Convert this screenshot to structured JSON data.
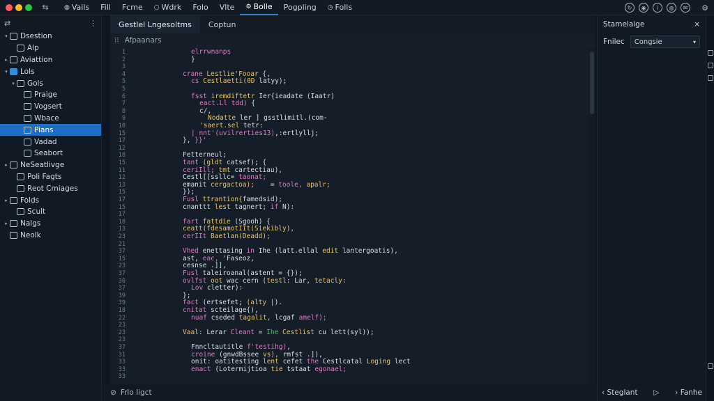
{
  "window": {
    "traffic_colors": [
      "#ff5f57",
      "#febc2e",
      "#28c840"
    ]
  },
  "menu": {
    "items": [
      {
        "label": "Vails",
        "icon": "globe-icon"
      },
      {
        "label": "Fill",
        "icon": ""
      },
      {
        "label": "Fcme",
        "icon": ""
      },
      {
        "label": "Wdrk",
        "icon": "circle-icon"
      },
      {
        "label": "Folo",
        "icon": ""
      },
      {
        "label": "Vlte",
        "icon": ""
      },
      {
        "label": "Bolle",
        "icon": "settings-icon"
      },
      {
        "label": "Pogpling",
        "icon": ""
      },
      {
        "label": "Folls",
        "icon": "clock-icon"
      }
    ],
    "active_index": 6
  },
  "sidebar": {
    "items": [
      {
        "label": "Dsestion",
        "depth": 0,
        "arrow": "▾"
      },
      {
        "label": "Alp",
        "depth": 1,
        "arrow": ""
      },
      {
        "label": "Aviattion",
        "depth": 0,
        "arrow": "▸"
      },
      {
        "label": "Lols",
        "depth": 0,
        "arrow": "▾",
        "blue": true
      },
      {
        "label": "Gols",
        "depth": 1,
        "arrow": "▾"
      },
      {
        "label": "Praige",
        "depth": 2,
        "arrow": ""
      },
      {
        "label": "Vogsert",
        "depth": 2,
        "arrow": ""
      },
      {
        "label": "Wbace",
        "depth": 2,
        "arrow": ""
      },
      {
        "label": "Pians",
        "depth": 2,
        "arrow": "",
        "selected": true
      },
      {
        "label": "Vadad",
        "depth": 2,
        "arrow": ""
      },
      {
        "label": "Seabort",
        "depth": 2,
        "arrow": ""
      },
      {
        "label": "NeSeatlivge",
        "depth": 0,
        "arrow": "▸"
      },
      {
        "label": "Poli Fagts",
        "depth": 1,
        "arrow": ""
      },
      {
        "label": "Reot Cmiages",
        "depth": 1,
        "arrow": ""
      },
      {
        "label": "Folds",
        "depth": 0,
        "arrow": "▸"
      },
      {
        "label": "Scult",
        "depth": 1,
        "arrow": ""
      },
      {
        "label": "Nalgs",
        "depth": 0,
        "arrow": "▸"
      },
      {
        "label": "Neolk",
        "depth": 0,
        "arrow": ""
      }
    ]
  },
  "editor": {
    "tabs": [
      {
        "label": "Gestlel Lngesoltms",
        "active": true
      },
      {
        "label": "Coptun",
        "active": false
      }
    ],
    "breadcrumb": "Afpaanars",
    "line_numbers": [
      "1",
      "2",
      "3",
      "4",
      "5",
      "5",
      "6",
      "7",
      "8",
      "9",
      "10",
      "15",
      "17",
      "12",
      "18",
      "15",
      "11",
      "12",
      "13",
      "15",
      "17",
      "15",
      "17",
      "18",
      "13",
      "23",
      "21",
      "37",
      "15",
      "23",
      "37",
      "30",
      "37",
      "39",
      "39",
      "18",
      "22",
      "23",
      "23",
      "23",
      "37",
      "31",
      "33",
      "33",
      "33"
    ],
    "lines": [
      {
        "indent": 6,
        "parts": [
          [
            "elrrwnanps",
            "#e07bc6"
          ]
        ]
      },
      {
        "indent": 6,
        "parts": [
          [
            "}",
            "#d7dee6"
          ]
        ]
      },
      {
        "indent": 0,
        "parts": []
      },
      {
        "indent": 5,
        "parts": [
          [
            "crane ",
            "#e07bc6"
          ],
          [
            "Lestlie'Fooar",
            "#e8c46a"
          ],
          [
            " {,",
            "#d7dee6"
          ]
        ]
      },
      {
        "indent": 6,
        "parts": [
          [
            "cs ",
            "#e07bc6"
          ],
          [
            "Cestlaetti(0D ",
            "#e8c46a"
          ],
          [
            "latyy);",
            "#d7dee6"
          ]
        ]
      },
      {
        "indent": 0,
        "parts": []
      },
      {
        "indent": 6,
        "parts": [
          [
            "fsst ",
            "#e07bc6"
          ],
          [
            "iremdiftetr ",
            "#e8c46a"
          ],
          [
            "Ier{ieadate (Iaatr)",
            "#d7dee6"
          ]
        ]
      },
      {
        "indent": 7,
        "parts": [
          [
            "eact.Ll tdd) ",
            "#e07bc6"
          ],
          [
            "{",
            "#d7dee6"
          ]
        ]
      },
      {
        "indent": 7,
        "parts": [
          [
            "c/,",
            "#d7dee6"
          ]
        ]
      },
      {
        "indent": 8,
        "parts": [
          [
            "Nodatte ",
            "#e8c46a"
          ],
          [
            "ler ] gsstlimitl.(com-",
            "#d7dee6"
          ]
        ]
      },
      {
        "indent": 7,
        "parts": [
          [
            "'saert.sel ",
            "#e8c46a"
          ],
          [
            "tetr:",
            "#d7dee6"
          ]
        ]
      },
      {
        "indent": 6,
        "parts": [
          [
            "| nnt'(uvilrerties13)",
            "#e07bc6"
          ],
          [
            ",:ertlyllj;",
            "#d7dee6"
          ]
        ]
      },
      {
        "indent": 5,
        "parts": [
          [
            "}, ",
            "#d7dee6"
          ],
          [
            "}}'",
            "#e07bc6"
          ]
        ]
      },
      {
        "indent": 0,
        "parts": []
      },
      {
        "indent": 5,
        "parts": [
          [
            "Fetterneul;",
            "#d7dee6"
          ]
        ]
      },
      {
        "indent": 5,
        "parts": [
          [
            "tant ",
            "#e07bc6"
          ],
          [
            "(gldt ",
            "#e8c46a"
          ],
          [
            "catsef); {",
            "#d7dee6"
          ]
        ]
      },
      {
        "indent": 5,
        "parts": [
          [
            "ceriIll; ",
            "#e07bc6"
          ],
          [
            "tmt ",
            "#e8c46a"
          ],
          [
            "cartectiau),",
            "#d7dee6"
          ]
        ]
      },
      {
        "indent": 5,
        "parts": [
          [
            "Cestl[[ssllc= ",
            "#d7dee6"
          ],
          [
            "taonat;",
            "#e07bc6"
          ]
        ]
      },
      {
        "indent": 5,
        "parts": [
          [
            "emanit ",
            "#d7dee6"
          ],
          [
            "cergactoa);",
            "#e8c46a"
          ],
          [
            "    = ",
            "#d7dee6"
          ],
          [
            "toole, ",
            "#e07bc6"
          ],
          [
            "apalr;",
            "#e8c46a"
          ]
        ]
      },
      {
        "indent": 5,
        "parts": [
          [
            "});",
            "#d7dee6"
          ]
        ]
      },
      {
        "indent": 5,
        "parts": [
          [
            "Fusl ",
            "#e07bc6"
          ],
          [
            "ttrantion{",
            "#e8c46a"
          ],
          [
            "famedsid);",
            "#d7dee6"
          ]
        ]
      },
      {
        "indent": 5,
        "parts": [
          [
            "cnanttt ",
            "#d7dee6"
          ],
          [
            "lest ",
            "#e8c46a"
          ],
          [
            "tagnert; ",
            "#d7dee6"
          ],
          [
            "if ",
            "#e07bc6"
          ],
          [
            "N):",
            "#d7dee6"
          ]
        ]
      },
      {
        "indent": 0,
        "parts": []
      },
      {
        "indent": 5,
        "parts": [
          [
            "fart ",
            "#e07bc6"
          ],
          [
            "fattdie ",
            "#e8c46a"
          ],
          [
            "(Sgooh) {",
            "#d7dee6"
          ]
        ]
      },
      {
        "indent": 5,
        "parts": [
          [
            "ceatt(fdesamotIIt(Siekibly),",
            "#e8c46a"
          ]
        ]
      },
      {
        "indent": 5,
        "parts": [
          [
            "cerIIt ",
            "#e07bc6"
          ],
          [
            "Baetlan(Deadd);",
            "#e8c46a"
          ]
        ]
      },
      {
        "indent": 0,
        "parts": []
      },
      {
        "indent": 5,
        "parts": [
          [
            "Vhed ",
            "#e07bc6"
          ],
          [
            "enettasing ",
            "#d7dee6"
          ],
          [
            "in ",
            "#e07bc6"
          ],
          [
            "Ihe (latt.ellal ",
            "#d7dee6"
          ],
          [
            "edit ",
            "#e8c46a"
          ],
          [
            "lantergoatis),",
            "#d7dee6"
          ]
        ]
      },
      {
        "indent": 5,
        "parts": [
          [
            "ast, ",
            "#d7dee6"
          ],
          [
            "eac, ",
            "#e07bc6"
          ],
          [
            "'Faseoz,",
            "#d7dee6"
          ]
        ]
      },
      {
        "indent": 5,
        "parts": [
          [
            "cesnse ",
            "#d7dee6"
          ],
          [
            ".]],",
            "#d7dee6"
          ]
        ]
      },
      {
        "indent": 5,
        "parts": [
          [
            "Fusl ",
            "#e07bc6"
          ],
          [
            "taleiroanal",
            "#d7dee6"
          ],
          [
            "(astent = {});",
            "#d7dee6"
          ]
        ]
      },
      {
        "indent": 5,
        "parts": [
          [
            "ovlfst ",
            "#e07bc6"
          ],
          [
            "oot ",
            "#e8c46a"
          ],
          [
            "wac ",
            "#d7dee6"
          ],
          [
            "cern (",
            "#d7dee6"
          ],
          [
            "testl:",
            "#e8c46a"
          ],
          [
            " Lar, ",
            "#d7dee6"
          ],
          [
            "tetacly:",
            "#e8c46a"
          ]
        ]
      },
      {
        "indent": 6,
        "parts": [
          [
            "Lov ",
            "#e07bc6"
          ],
          [
            "cletter):",
            "#d7dee6"
          ]
        ]
      },
      {
        "indent": 5,
        "parts": [
          [
            "};",
            "#d7dee6"
          ]
        ]
      },
      {
        "indent": 5,
        "parts": [
          [
            "fact ",
            "#e07bc6"
          ],
          [
            "(ertsefet; ",
            "#d7dee6"
          ],
          [
            "(alty ",
            "#e8c46a"
          ],
          [
            "|).",
            "#d7dee6"
          ]
        ]
      },
      {
        "indent": 5,
        "parts": [
          [
            "cnitat ",
            "#e07bc6"
          ],
          [
            "scteilage{),",
            "#d7dee6"
          ]
        ]
      },
      {
        "indent": 6,
        "parts": [
          [
            "nuaf ",
            "#e07bc6"
          ],
          [
            "cseded ",
            "#d7dee6"
          ],
          [
            "tagalit, ",
            "#e8c46a"
          ],
          [
            "lcgaf ",
            "#d7dee6"
          ],
          [
            "amelf);",
            "#e07bc6"
          ]
        ]
      },
      {
        "indent": 0,
        "parts": []
      },
      {
        "indent": 5,
        "parts": [
          [
            "Vaal: ",
            "#e8c46a"
          ],
          [
            "Lerar ",
            "#d7dee6"
          ],
          [
            "Cleant ",
            "#e07bc6"
          ],
          [
            "= ",
            "#d7dee6"
          ],
          [
            "Ihe ",
            "#53c26a"
          ],
          [
            "Cestlist ",
            "#e8c46a"
          ],
          [
            "cu ",
            "#d7dee6"
          ],
          [
            "lett(syl));",
            "#d7dee6"
          ]
        ]
      },
      {
        "indent": 0,
        "parts": []
      },
      {
        "indent": 6,
        "parts": [
          [
            "Fnncltautitle ",
            "#d7dee6"
          ],
          [
            "f'testihg)",
            "#e07bc6"
          ],
          [
            ",",
            "#d7dee6"
          ]
        ]
      },
      {
        "indent": 6,
        "parts": [
          [
            "croine ",
            "#e07bc6"
          ],
          [
            "(gnwdBssee ",
            "#d7dee6"
          ],
          [
            "vs), ",
            "#e8c46a"
          ],
          [
            "rmfst ",
            "#d7dee6"
          ],
          [
            ".]),",
            "#d7dee6"
          ]
        ]
      },
      {
        "indent": 6,
        "parts": [
          [
            "onit: ",
            "#d7dee6"
          ],
          [
            "oatitesting ",
            "#d7dee6"
          ],
          [
            "lent ",
            "#e8c46a"
          ],
          [
            "cefet ",
            "#d7dee6"
          ],
          [
            "the ",
            "#e07bc6"
          ],
          [
            "Cestlcatal ",
            "#d7dee6"
          ],
          [
            "Loging ",
            "#e8c46a"
          ],
          [
            "lect",
            "#d7dee6"
          ]
        ]
      },
      {
        "indent": 6,
        "parts": [
          [
            "enact ",
            "#e07bc6"
          ],
          [
            "(Lotermijtioa ",
            "#d7dee6"
          ],
          [
            "tie ",
            "#e8c46a"
          ],
          [
            "tstaat ",
            "#d7dee6"
          ],
          [
            "egonael;",
            "#e07bc6"
          ]
        ]
      }
    ]
  },
  "status": {
    "label": "Frlo Iigct"
  },
  "right_panel": {
    "title": "Stamelaige",
    "row_label": "Fnilec",
    "select_value": "Congsie",
    "footer_left": "Steglant",
    "footer_right": "Fanhe"
  }
}
